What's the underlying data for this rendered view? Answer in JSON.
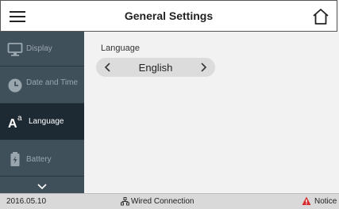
{
  "header": {
    "title": "General Settings",
    "menu_icon": "hamburger-menu-icon",
    "home_icon": "home-icon"
  },
  "sidebar": {
    "items": [
      {
        "label": "Display",
        "icon": "monitor-icon"
      },
      {
        "label": "Date and Time",
        "icon": "clock-icon"
      },
      {
        "label": "Language",
        "icon": "language-icon",
        "active": true
      },
      {
        "label": "Battery",
        "icon": "battery-icon"
      }
    ],
    "more_icon": "chevron-down-icon"
  },
  "main": {
    "language_label": "Language",
    "language_value": "English"
  },
  "statusbar": {
    "date": "2016.05.10",
    "connection": "Wired Connection",
    "notice": "Notice"
  },
  "colors": {
    "sidebar_bg": "#40505b",
    "sidebar_active_bg": "#1e2a33",
    "notice_red": "#d92b2b"
  }
}
